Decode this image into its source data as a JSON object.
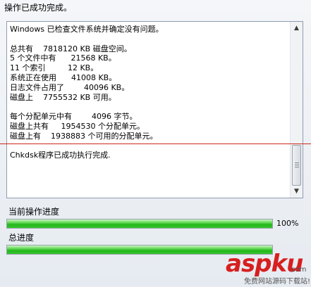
{
  "window": {
    "title": "操作已成功完成。"
  },
  "log": {
    "lines": [
      "Windows 已检查文件系统并确定没有问题。",
      "",
      "总共有    7818120 KB 磁盘空间。",
      "5 个文件中有      21568 KB。",
      "11 个索引         12 KB。",
      "系统正在使用      41008 KB。",
      "日志文件占用了        40096 KB。",
      "磁盘上    7755532 KB 可用。",
      "",
      "每个分配单元中有        4096 字节。",
      "磁盘上共有     1954530 个分配单元。",
      "磁盘上有    1938883 个可用的分配单元。",
      "",
      "Chkdsk程序已成功执行完成."
    ]
  },
  "progress": {
    "current_label": "当前操作进度",
    "current_value": 1.0,
    "current_percent_text": "100%",
    "total_label": "总进度",
    "total_value": 1.0
  },
  "watermark": {
    "logo_text": "aspku",
    "logo_suffix": ".com",
    "tagline": "免费网站源码下载站!"
  },
  "colors": {
    "progress_green": "#22b71c",
    "annotation_red": "#d0271f"
  }
}
